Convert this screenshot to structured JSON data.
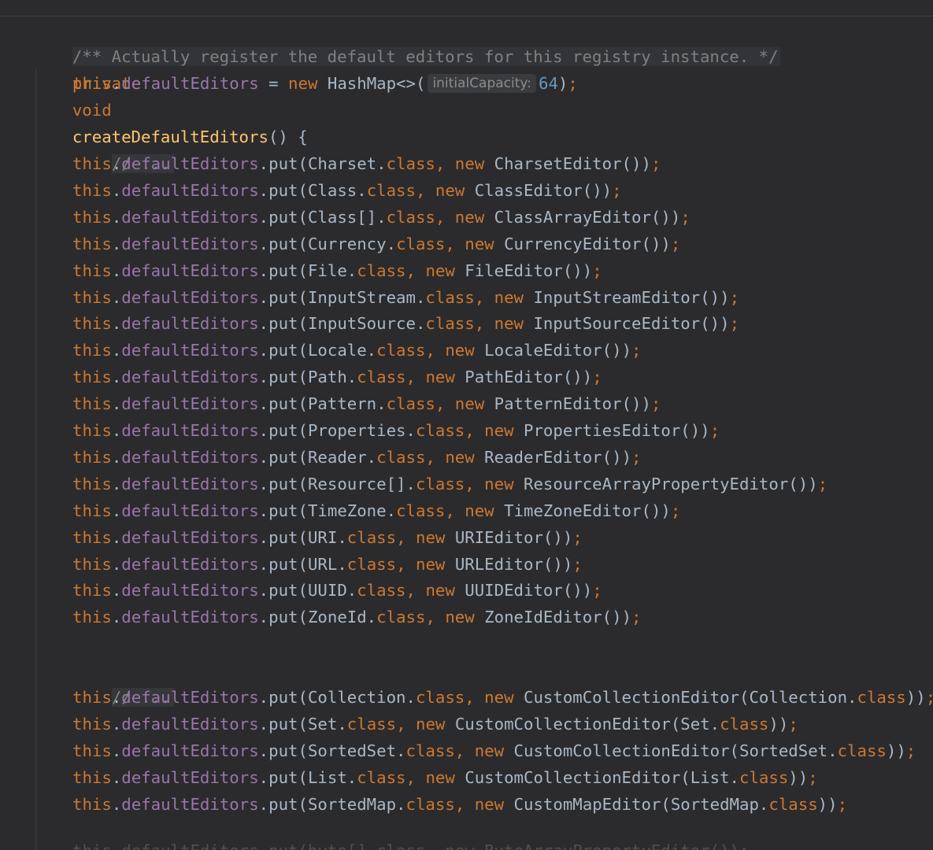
{
  "code": {
    "doc_comment": "/** Actually register the default editors for this registry instance. */",
    "method_decl": {
      "modifier": "private",
      "return_type": "void",
      "name": "createDefaultEditors",
      "params_open": "() {"
    },
    "init_line": {
      "this_kw": "this",
      "field": "defaultEditors",
      "assign": " = ",
      "new_kw": "new",
      "type": " HashMap<>(",
      "hint_label": "initialCapacity:",
      "hint_value": "64",
      "end": ");"
    },
    "section_comment_1": "// ...",
    "section_comment_2": "// ...",
    "common": {
      "this_kw": "this",
      "dot": ".",
      "field": "defaultEditors",
      "put": ".put(",
      "class_kw": "class",
      "comma": ", ",
      "new_kw": "new"
    },
    "group1": [
      {
        "key": "Charset.",
        "editor": " CharsetEditor",
        "tail": "());"
      },
      {
        "key": "Class.",
        "editor": " ClassEditor",
        "tail": "());"
      },
      {
        "key": "Class[].",
        "editor": " ClassArrayEditor",
        "tail": "());"
      },
      {
        "key": "Currency.",
        "editor": " CurrencyEditor",
        "tail": "());"
      },
      {
        "key": "File.",
        "editor": " FileEditor",
        "tail": "());"
      },
      {
        "key": "InputStream.",
        "editor": " InputStreamEditor",
        "tail": "());"
      },
      {
        "key": "InputSource.",
        "editor": " InputSourceEditor",
        "tail": "());"
      },
      {
        "key": "Locale.",
        "editor": " LocaleEditor",
        "tail": "());"
      },
      {
        "key": "Path.",
        "editor": " PathEditor",
        "tail": "());"
      },
      {
        "key": "Pattern.",
        "editor": " PatternEditor",
        "tail": "());"
      },
      {
        "key": "Properties.",
        "editor": " PropertiesEditor",
        "tail": "());"
      },
      {
        "key": "Reader.",
        "editor": " ReaderEditor",
        "tail": "());"
      },
      {
        "key": "Resource[].",
        "editor": " ResourceArrayPropertyEditor",
        "tail": "());"
      },
      {
        "key": "TimeZone.",
        "editor": " TimeZoneEditor",
        "tail": "());"
      },
      {
        "key": "URI.",
        "editor": " URIEditor",
        "tail": "());"
      },
      {
        "key": "URL.",
        "editor": " URLEditor",
        "tail": "());"
      },
      {
        "key": "UUID.",
        "editor": " UUIDEditor",
        "tail": "());"
      },
      {
        "key": "ZoneId.",
        "editor": " ZoneIdEditor",
        "tail": "());"
      }
    ],
    "group2": [
      {
        "key": "Collection.",
        "editor": " CustomCollectionEditor(",
        "arg": "Collection.",
        "tail": "));"
      },
      {
        "key": "Set.",
        "editor": " CustomCollectionEditor(",
        "arg": "Set.",
        "tail": "));"
      },
      {
        "key": "SortedSet.",
        "editor": " CustomCollectionEditor(",
        "arg": "SortedSet.",
        "tail": "));"
      },
      {
        "key": "List.",
        "editor": " CustomCollectionEditor(",
        "arg": "List.",
        "tail": "));"
      },
      {
        "key": "SortedMap.",
        "editor": " CustomMapEditor(",
        "arg": "SortedMap.",
        "tail": "));"
      }
    ],
    "clipped_line": "this.defaultEditors.put(byte[].class, new ByteArrayPropertyEditor());"
  }
}
